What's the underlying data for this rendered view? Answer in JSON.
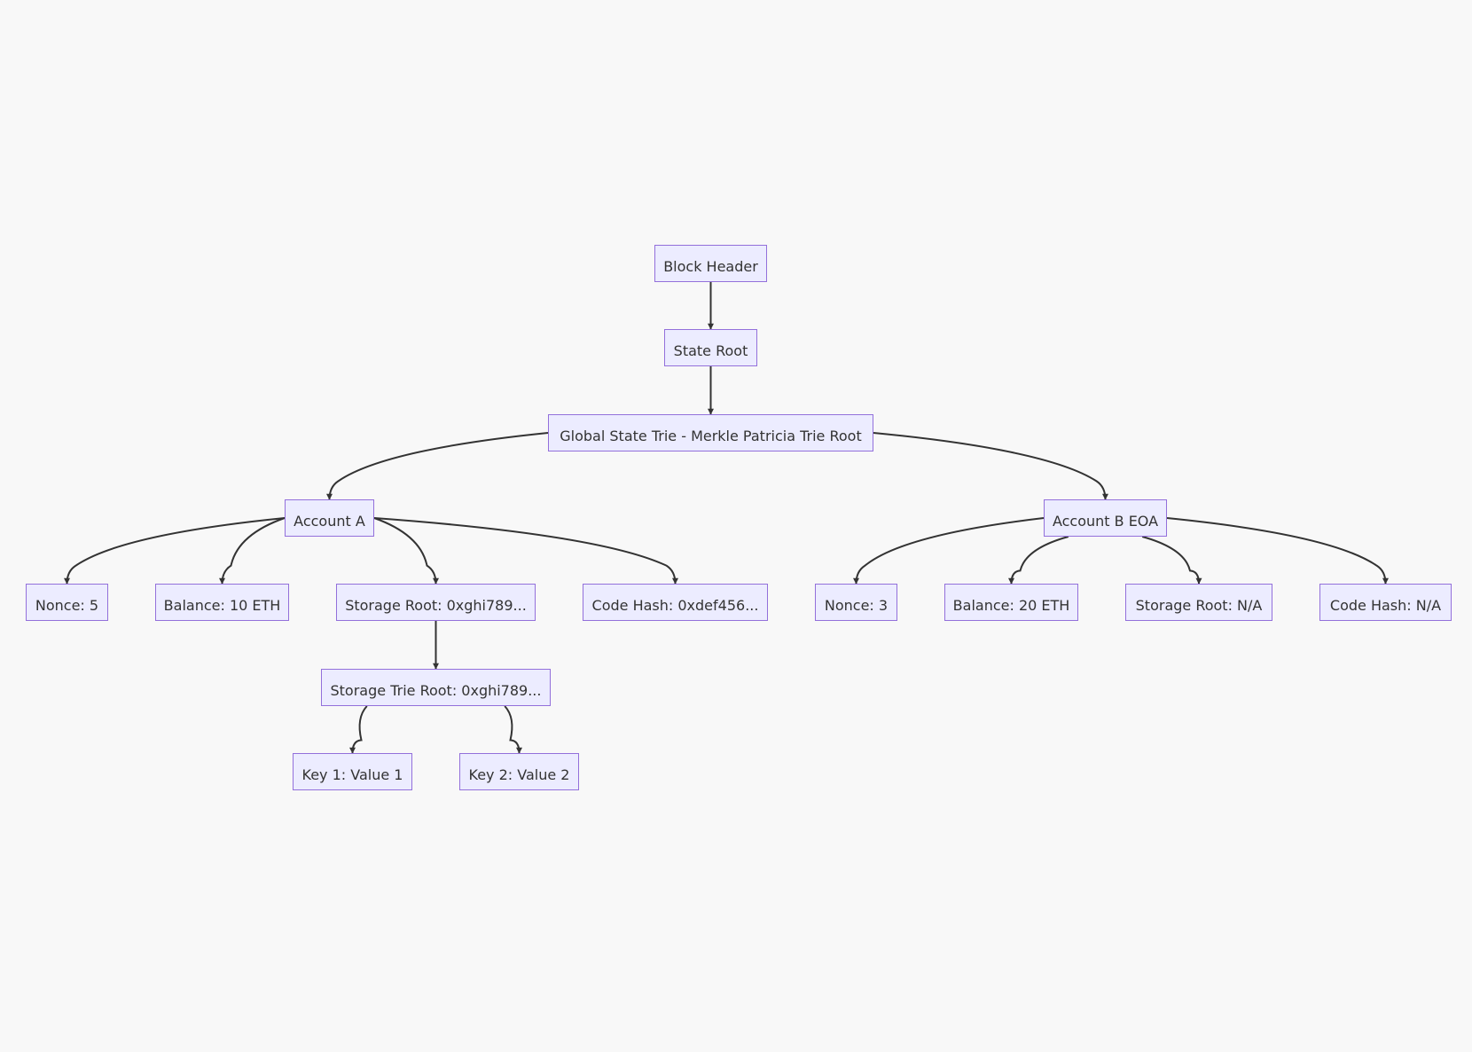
{
  "diagram": {
    "type": "flowchart-tree",
    "colors": {
      "background": "#f8f8f8",
      "node_fill": "#ececff",
      "node_border": "#9370db",
      "edge": "#333333",
      "text": "#333333"
    },
    "nodes": {
      "block_header": "Block Header",
      "state_root": "State Root",
      "global_state_trie": "Global State Trie - Merkle Patricia Trie Root",
      "account_a": "Account A",
      "account_b": "Account B EOA",
      "a_nonce": "Nonce: 5",
      "a_balance": "Balance: 10 ETH",
      "a_storage_root": "Storage Root: 0xghi789...",
      "a_code_hash": "Code Hash: 0xdef456...",
      "b_nonce": "Nonce: 3",
      "b_balance": "Balance: 20 ETH",
      "b_storage_root": "Storage Root: N/A",
      "b_code_hash": "Code Hash: N/A",
      "storage_trie_root": "Storage Trie Root: 0xghi789...",
      "key1": "Key 1: Value 1",
      "key2": "Key 2: Value 2"
    },
    "edges": [
      [
        "block_header",
        "state_root"
      ],
      [
        "state_root",
        "global_state_trie"
      ],
      [
        "global_state_trie",
        "account_a"
      ],
      [
        "global_state_trie",
        "account_b"
      ],
      [
        "account_a",
        "a_nonce"
      ],
      [
        "account_a",
        "a_balance"
      ],
      [
        "account_a",
        "a_storage_root"
      ],
      [
        "account_a",
        "a_code_hash"
      ],
      [
        "account_b",
        "b_nonce"
      ],
      [
        "account_b",
        "b_balance"
      ],
      [
        "account_b",
        "b_storage_root"
      ],
      [
        "account_b",
        "b_code_hash"
      ],
      [
        "a_storage_root",
        "storage_trie_root"
      ],
      [
        "storage_trie_root",
        "key1"
      ],
      [
        "storage_trie_root",
        "key2"
      ]
    ]
  }
}
